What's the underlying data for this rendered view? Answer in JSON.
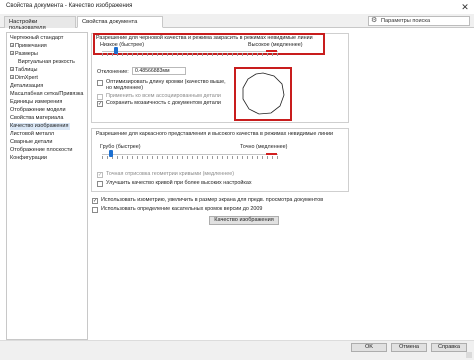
{
  "window": {
    "title": "Свойства документа - Качество изображения",
    "close_glyph": "✕"
  },
  "tabs": [
    {
      "label": "Настройки пользователя"
    },
    {
      "label": "Свойства документа"
    }
  ],
  "search": {
    "placeholder": "Параметры поиска"
  },
  "tree": [
    {
      "label": "Чертежный стандарт",
      "expander": ""
    },
    {
      "label": "Примечания",
      "expander": "+"
    },
    {
      "label": "Размеры",
      "expander": "+"
    },
    {
      "label": "Виртуальная резкость",
      "expander": ""
    },
    {
      "label": "Таблицы",
      "expander": "+"
    },
    {
      "label": "DimXpert",
      "expander": "+"
    },
    {
      "label": "Детализация",
      "expander": ""
    },
    {
      "label": "Масштабная сетка/Привязка",
      "expander": ""
    },
    {
      "label": "Единицы измерения",
      "expander": ""
    },
    {
      "label": "Отображение модели",
      "expander": ""
    },
    {
      "label": "Свойства материала",
      "expander": ""
    },
    {
      "label": "Качество изображения",
      "expander": ""
    },
    {
      "label": "Листовой металл",
      "expander": ""
    },
    {
      "label": "Сварные детали",
      "expander": ""
    },
    {
      "label": "Отображение плоскости",
      "expander": ""
    },
    {
      "label": "Конфигурации",
      "expander": ""
    }
  ],
  "shaded": {
    "heading": "Разрешение для черновой качества и режима закрасить в режимах невидимые линии",
    "low_label": "Низкое (быстрее)",
    "high_label": "Высокое (медленнее)",
    "deviation_label": "Отклонение:",
    "deviation_value": "0.48566883мм",
    "optimize_label": "Оптимизировать длину кромки (качество выше, но медленнее)",
    "apply_all_label": "Применить ко всем ассоциированным детали",
    "save_mosaic_label": "Сохранить мозаичность с документом детали"
  },
  "wireframe": {
    "heading": "Разрешение для каркасного представления и высокого качества в режимах невидимые линии",
    "rough_label": "Грубо (быстрее)",
    "precise_label": "Точно (медленнее)",
    "precise_render_label": "Точная отрисовка геометрии кривыми (медленнее)",
    "improve_curve_label": "Улучшить качество кривой при более высоких настройках"
  },
  "options": {
    "isometric_label": "Использовать изометрию, увеличить в размер экрана для предв. просмотра документов",
    "tangent_label": "Использовать определение касательных кромок версии до 2009",
    "image_quality_button": "Качество изображения"
  },
  "footer": {
    "ok": "OK",
    "cancel": "Отмена",
    "help": "Справка"
  },
  "states": {
    "shaded_slider_fraction": 0.08,
    "wire_slider_fraction": 0.05,
    "optimize_checked": false,
    "apply_all_checked": false,
    "save_mosaic_checked": true,
    "precise_render_checked": true,
    "improve_curve_checked": false,
    "isometric_checked": true,
    "tangent_checked": false
  },
  "colors": {
    "slider_thumb": "#1b6fd1",
    "highlight_red": "#c81d1d"
  }
}
